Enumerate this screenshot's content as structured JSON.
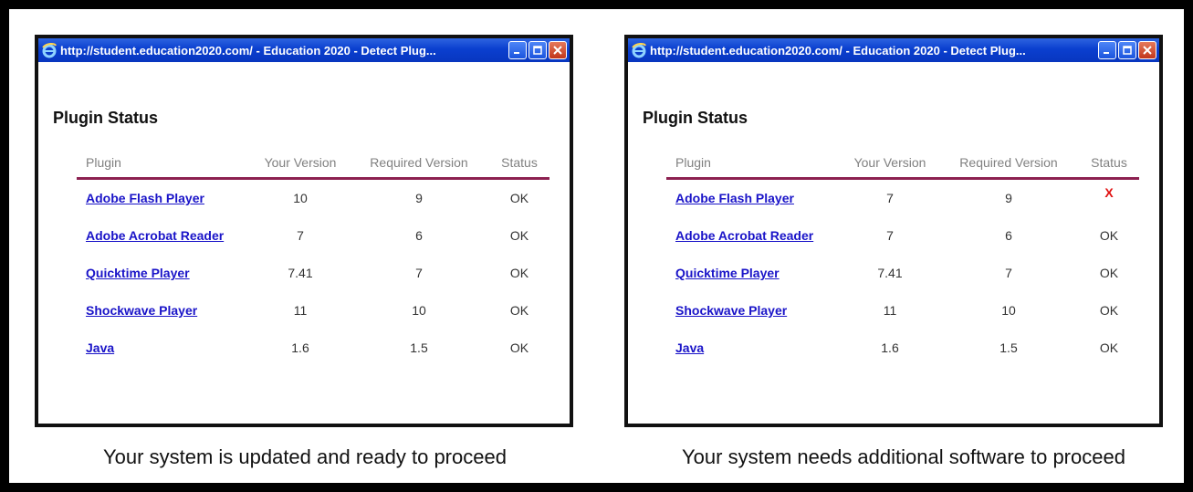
{
  "panels": [
    {
      "window_title": "http://student.education2020.com/ - Education 2020 - Detect Plug...",
      "heading": "Plugin Status",
      "columns": [
        "Plugin",
        "Your Version",
        "Required Version",
        "Status"
      ],
      "rows": [
        {
          "plugin": "Adobe Flash Player",
          "your": "10",
          "required": "9",
          "status": "OK"
        },
        {
          "plugin": "Adobe Acrobat Reader",
          "your": "7",
          "required": "6",
          "status": "OK"
        },
        {
          "plugin": "Quicktime Player",
          "your": "7.41",
          "required": "7",
          "status": "OK"
        },
        {
          "plugin": "Shockwave Player",
          "your": "11",
          "required": "10",
          "status": "OK"
        },
        {
          "plugin": "Java",
          "your": "1.6",
          "required": "1.5",
          "status": "OK"
        }
      ],
      "caption": "Your system is updated and ready to proceed"
    },
    {
      "window_title": "http://student.education2020.com/ - Education 2020 - Detect Plug...",
      "heading": "Plugin Status",
      "columns": [
        "Plugin",
        "Your Version",
        "Required Version",
        "Status"
      ],
      "rows": [
        {
          "plugin": "Adobe Flash Player",
          "your": "7",
          "required": "9",
          "status": "X"
        },
        {
          "plugin": "Adobe Acrobat Reader",
          "your": "7",
          "required": "6",
          "status": "OK"
        },
        {
          "plugin": "Quicktime Player",
          "your": "7.41",
          "required": "7",
          "status": "OK"
        },
        {
          "plugin": "Shockwave Player",
          "your": "11",
          "required": "10",
          "status": "OK"
        },
        {
          "plugin": "Java",
          "your": "1.6",
          "required": "1.5",
          "status": "OK"
        }
      ],
      "caption": "Your system needs additional software to proceed"
    }
  ],
  "icons": {
    "browser": "internet-explorer-icon",
    "minimize": "minimize-icon",
    "maximize": "maximize-icon",
    "close": "close-icon"
  },
  "colors": {
    "titlebar": "#0a3fcf",
    "header_rule": "#8c2050",
    "link": "#1a14c8",
    "fail_mark": "#e01010"
  }
}
